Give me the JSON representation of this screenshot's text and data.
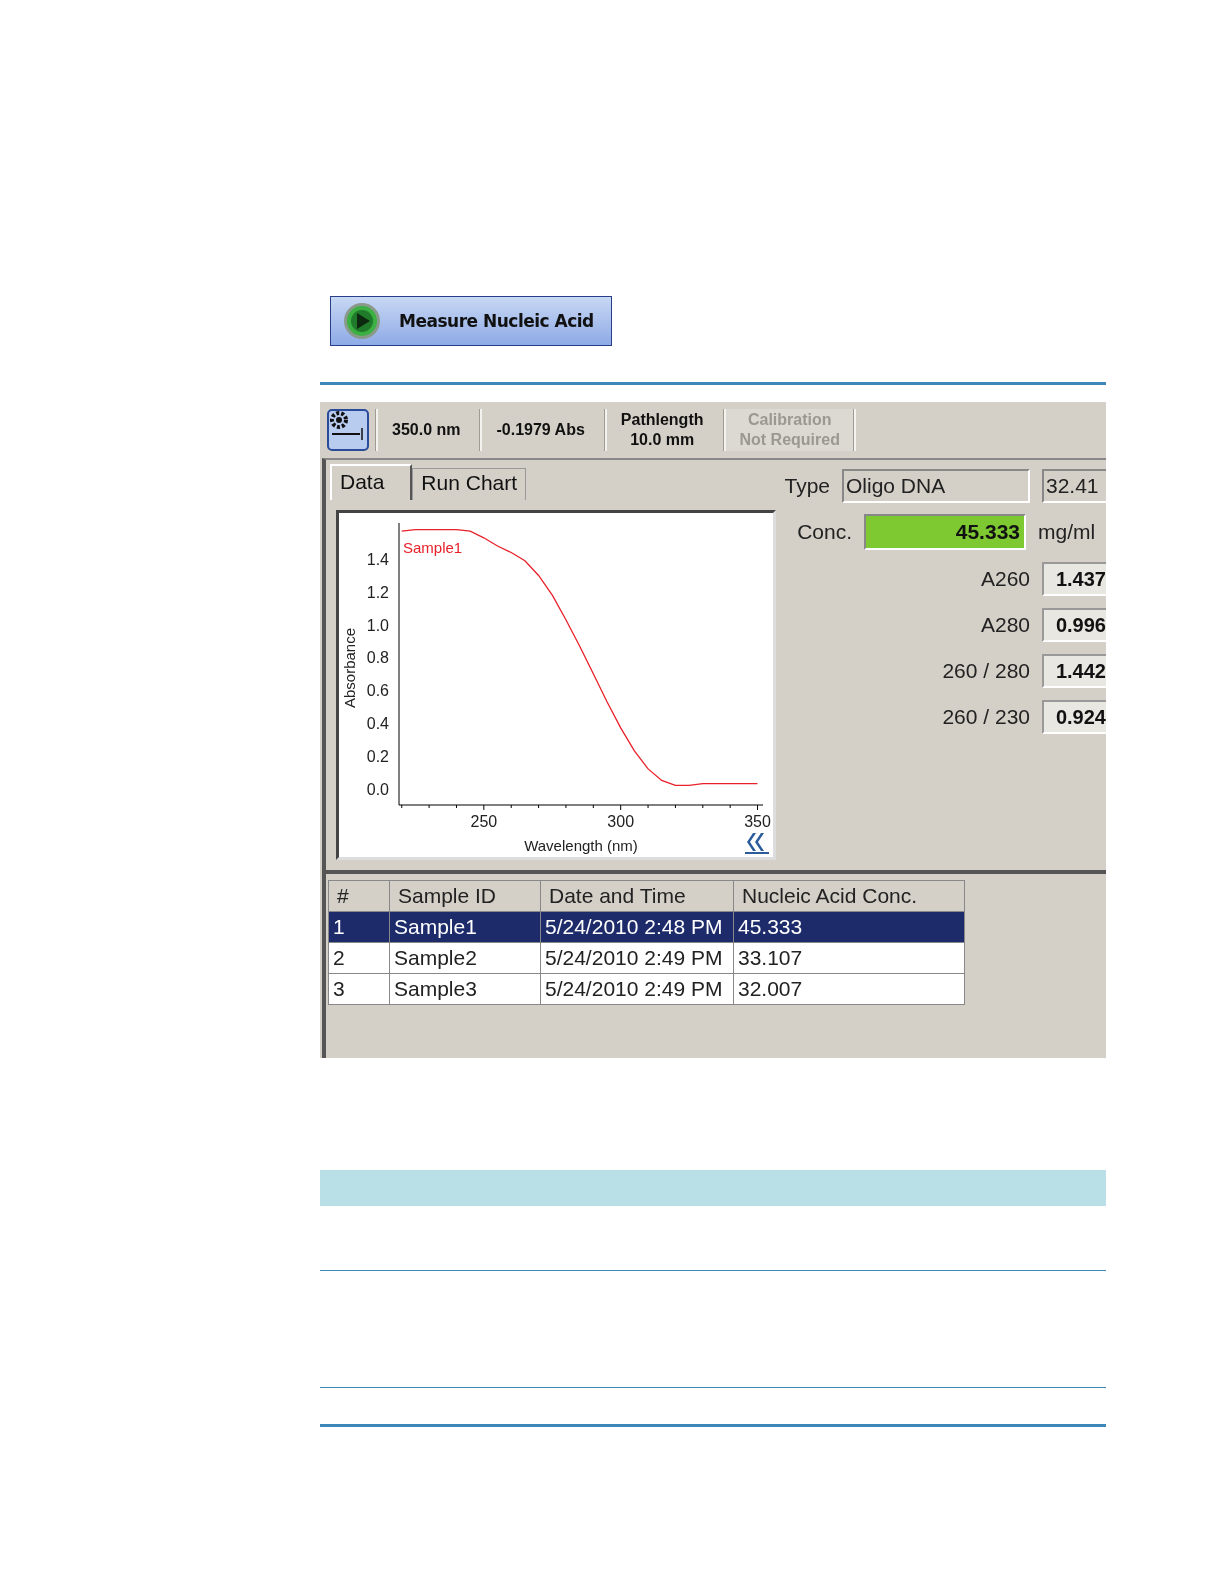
{
  "measure_button": {
    "label": "Measure Nucleic Acid"
  },
  "toolbar": {
    "items": [
      {
        "kind": "single",
        "text": "350.0 nm",
        "disabled": false
      },
      {
        "kind": "single",
        "text": "-0.1979 Abs",
        "disabled": false
      },
      {
        "kind": "double",
        "text": "Pathlength",
        "subtext": "10.0 mm",
        "disabled": false
      },
      {
        "kind": "double",
        "text": "Calibration",
        "subtext": "Not Required",
        "disabled": true
      }
    ]
  },
  "tabs": [
    {
      "label": "Data",
      "selected": true
    },
    {
      "label": "Run Chart",
      "selected": false
    }
  ],
  "type_field": {
    "label": "Type",
    "value": "Oligo DNA",
    "extra": "32.41"
  },
  "concentration": {
    "label": "Conc.",
    "value": "45.333",
    "unit": "mg/ml"
  },
  "metrics": [
    {
      "label": "A260",
      "value": "1.437"
    },
    {
      "label": "A280",
      "value": "0.996"
    },
    {
      "label": "260 / 280",
      "value": "1.442"
    },
    {
      "label": "260 / 230",
      "value": "0.924"
    }
  ],
  "chart": {
    "chart_data": {
      "type": "line",
      "xlabel": "Wavelength (nm)",
      "ylabel": "Absorbance",
      "xlim": [
        219,
        352
      ],
      "ylim": [
        -0.1,
        1.62
      ],
      "xticks": [
        250,
        300,
        350
      ],
      "yticks": [
        {
          "value": 0,
          "label": "0.0"
        },
        {
          "value": 0.2,
          "label": "0.2"
        },
        {
          "value": 0.4,
          "label": "0.4"
        },
        {
          "value": 0.6,
          "label": "0.6"
        },
        {
          "value": 0.8,
          "label": "0.8"
        },
        {
          "value": 1,
          "label": "1.0"
        },
        {
          "value": 1.2,
          "label": "1.2"
        },
        {
          "value": 1.4,
          "label": "1.4"
        }
      ],
      "x": [
        220,
        225,
        230,
        235,
        240,
        245,
        250,
        255,
        260,
        265,
        270,
        275,
        280,
        285,
        290,
        295,
        300,
        305,
        310,
        315,
        320,
        325,
        330,
        335,
        340,
        345,
        350
      ],
      "series": [
        {
          "name": "Sample1",
          "color": "#e8202a",
          "values": [
            1.57,
            1.58,
            1.58,
            1.58,
            1.58,
            1.57,
            1.53,
            1.48,
            1.44,
            1.39,
            1.3,
            1.18,
            1.03,
            0.87,
            0.7,
            0.53,
            0.37,
            0.23,
            0.12,
            0.05,
            0.02,
            0.02,
            0.03,
            0.03,
            0.03,
            0.03,
            0.03
          ]
        }
      ]
    }
  },
  "table": {
    "columns": [
      "#",
      "Sample ID",
      "Date and Time",
      "Nucleic Acid Conc."
    ],
    "rows": [
      {
        "cells": [
          "1",
          "Sample1",
          "5/24/2010 2:48 PM",
          "45.333"
        ],
        "selected": true
      },
      {
        "cells": [
          "2",
          "Sample2",
          "5/24/2010 2:49 PM",
          "33.107"
        ],
        "selected": false
      },
      {
        "cells": [
          "3",
          "Sample3",
          "5/24/2010 2:49 PM",
          "32.007"
        ],
        "selected": false
      }
    ]
  }
}
